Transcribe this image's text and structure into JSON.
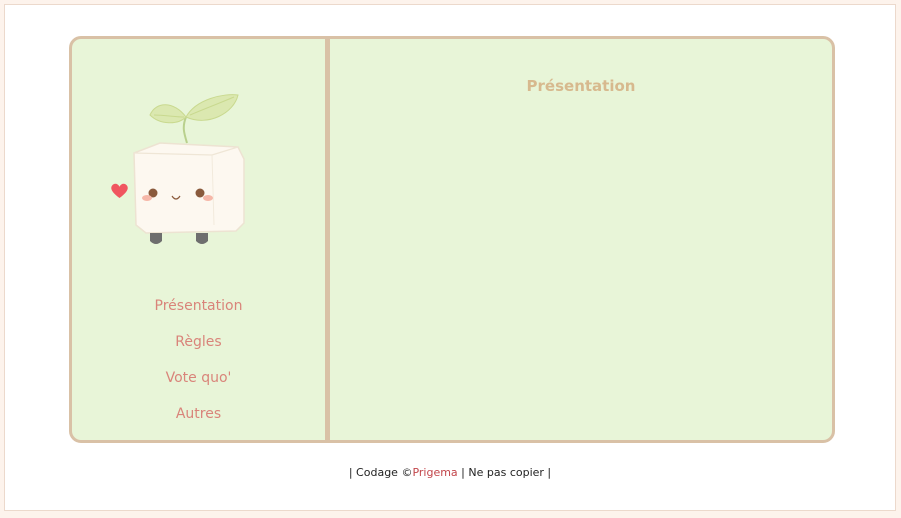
{
  "nav": {
    "items": [
      {
        "label": "Présentation"
      },
      {
        "label": "Règles"
      },
      {
        "label": "Vote quo'"
      },
      {
        "label": "Autres"
      }
    ]
  },
  "content": {
    "title": "Présentation"
  },
  "footer": {
    "prefix": "| Codage ©",
    "author": "Prigema",
    "suffix": " | Ne pas copier |"
  },
  "colors": {
    "panel_bg": "#e8f5d8",
    "border": "#d9c1a6",
    "nav_text": "#d9847a",
    "title_text": "#d7b98e",
    "link": "#c2454a"
  },
  "icons": {
    "mascot": "tofu-sprout-mascot-icon",
    "heart": "heart-icon"
  }
}
